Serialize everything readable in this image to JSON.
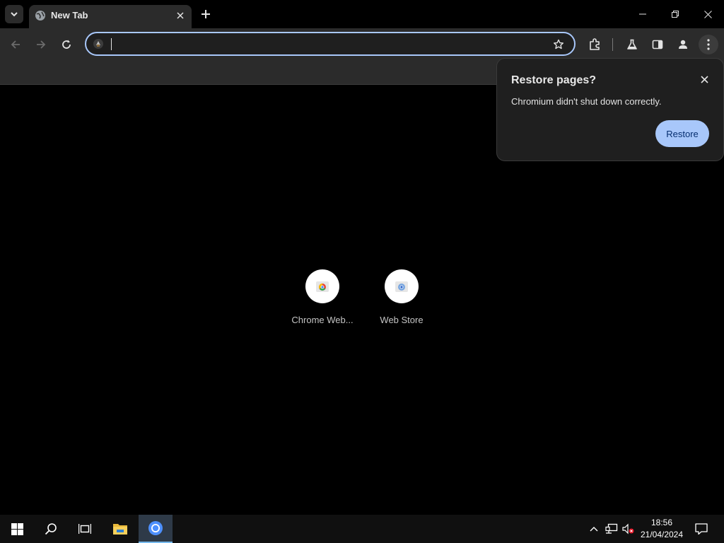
{
  "tabs": [
    {
      "title": "New Tab",
      "favicon": "globe-icon"
    }
  ],
  "window_controls": [
    "minimize-icon",
    "restore-window-icon",
    "close-icon"
  ],
  "toolbar": {
    "back_icon": "back-arrow-icon",
    "forward_icon": "forward-arrow-icon",
    "reload_icon": "reload-icon",
    "omnibox": {
      "value": "",
      "placeholder": "",
      "icon": "search-engine-icon"
    },
    "right_icons": [
      "bookmark-star-icon",
      "extensions-icon",
      "labs-flask-icon",
      "side-panel-icon",
      "profile-icon",
      "menu-kebab-icon"
    ]
  },
  "restore_bubble": {
    "title": "Restore pages?",
    "message": "Chromium didn't shut down correctly.",
    "button_label": "Restore"
  },
  "shortcuts": [
    {
      "label": "Chrome Web...",
      "icon": "chrome-web-store-icon"
    },
    {
      "label": "Web Store",
      "icon": "web-store-icon"
    }
  ],
  "taskbar": {
    "items": [
      "windows-start-icon",
      "search-icon",
      "task-view-icon",
      "file-explorer-icon",
      "chromium-icon"
    ],
    "tray_icons": [
      "show-hidden-icons-chevron",
      "network-icon",
      "volume-muted-icon",
      "notifications-icon"
    ],
    "time": "18:56",
    "date": "21/04/2024"
  },
  "colors": {
    "accent": "#a8c7fa",
    "toolbar_bg": "#2b2b2b",
    "page_bg": "#000000",
    "bubble_bg": "#1f1f1f"
  }
}
